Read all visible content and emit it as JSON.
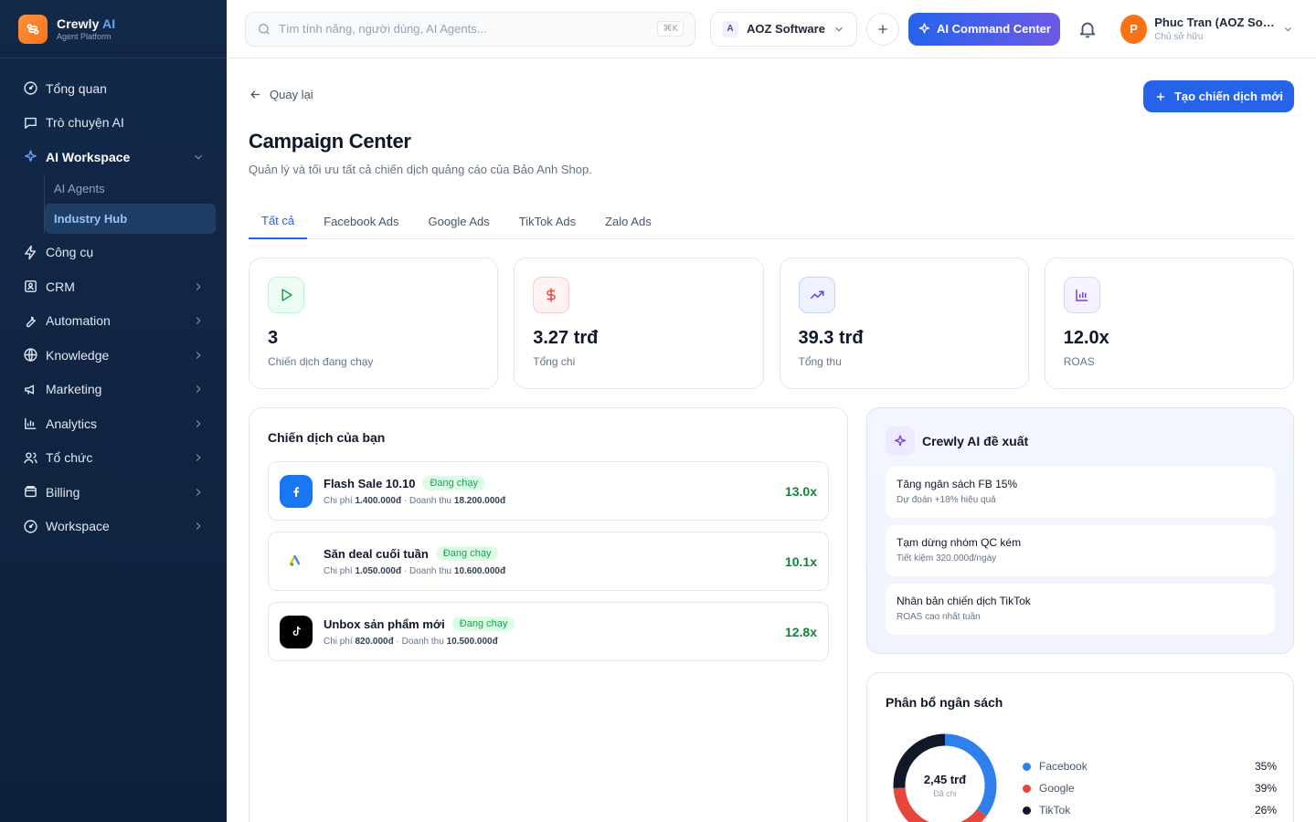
{
  "brand": {
    "name": "Crewly",
    "name_accent": "AI",
    "subtitle": "Agent Platform"
  },
  "sidebar": {
    "items": [
      {
        "label": "Tổng quan",
        "icon": "dashboard-icon"
      },
      {
        "label": "Trò chuyện AI",
        "icon": "chat-icon"
      },
      {
        "label": "AI Workspace",
        "icon": "sparkle-icon",
        "expanded": true
      },
      {
        "label": "Công cụ",
        "icon": "bolt-icon"
      },
      {
        "label": "CRM",
        "icon": "contact-icon"
      },
      {
        "label": "Automation",
        "icon": "wrench-icon"
      },
      {
        "label": "Knowledge",
        "icon": "globe-icon"
      },
      {
        "label": "Marketing",
        "icon": "megaphone-icon"
      },
      {
        "label": "Analytics",
        "icon": "bar-chart-icon"
      },
      {
        "label": "Tổ chức",
        "icon": "users-icon"
      },
      {
        "label": "Billing",
        "icon": "wallet-icon"
      },
      {
        "label": "Workspace",
        "icon": "dashboard-icon"
      }
    ],
    "sub_items": [
      {
        "label": "AI Agents"
      },
      {
        "label": "Industry Hub",
        "active": true
      }
    ]
  },
  "header": {
    "search_placeholder": "Tìm tính năng, người dùng, AI Agents...",
    "search_shortcut": "⌘K",
    "org_badge": "A",
    "org_name": "AOZ Software",
    "ai_button": "AI Command Center",
    "user_initial": "P",
    "user_name": "Phuc Tran (AOZ Software)",
    "user_role": "Chủ sở hữu"
  },
  "main": {
    "back_label": "Quay lại",
    "create_button": "Tạo chiến dịch mới",
    "title": "Campaign Center",
    "subtitle": "Quản lý và tối ưu tất cả chiến dịch quảng cáo của Bảo Anh Shop.",
    "tabs": [
      "Tất cả",
      "Facebook Ads",
      "Google Ads",
      "TikTok Ads",
      "Zalo Ads"
    ],
    "active_tab": 0
  },
  "stats": [
    {
      "value": "3",
      "label": "Chiến dịch đang chạy",
      "icon": "play-icon",
      "color": "#16a34a"
    },
    {
      "value": "3.27 trđ",
      "label": "Tổng chi",
      "icon": "dollar-icon",
      "color": "#ef4444"
    },
    {
      "value": "39.3 trđ",
      "label": "Tổng thu",
      "icon": "trending-up-icon",
      "color": "#4f46e5"
    },
    {
      "value": "12.0x",
      "label": "ROAS",
      "icon": "bar-chart-icon",
      "color": "#7c3aed"
    }
  ],
  "campaigns": {
    "title": "Chiến dịch của bạn",
    "items": [
      {
        "name": "Flash Sale 10.10",
        "status": "Đang chạy",
        "cost_label": "Chi phí",
        "cost": "1.400.000đ",
        "revenue_label": "Doanh thu",
        "revenue": "18.200.000đ",
        "roas": "13.0x",
        "platform_icon": "facebook-icon"
      },
      {
        "name": "Săn deal cuối tuần",
        "status": "Đang chạy",
        "cost_label": "Chi phí",
        "cost": "1.050.000đ",
        "revenue_label": "Doanh thu",
        "revenue": "10.600.000đ",
        "roas": "10.1x",
        "platform_icon": "google-ads-icon"
      },
      {
        "name": "Unbox sản phẩm mới",
        "status": "Đang chạy",
        "cost_label": "Chi phí",
        "cost": "820.000đ",
        "revenue_label": "Doanh thu",
        "revenue": "10.500.000đ",
        "roas": "12.8x",
        "platform_icon": "tiktok-icon"
      }
    ]
  },
  "ai_suggestions": {
    "title": "Crewly AI đề xuất",
    "items": [
      {
        "title": "Tăng ngân sách FB 15%",
        "sub": "Dự đoán +18% hiệu quả"
      },
      {
        "title": "Tạm dừng nhóm QC kém",
        "sub": "Tiết kiệm 320.000đ/ngày"
      },
      {
        "title": "Nhân bản chiến dịch TikTok",
        "sub": "ROAS cao nhất tuần"
      }
    ]
  },
  "budget": {
    "title": "Phân bổ ngân sách",
    "center_value": "2,45 trđ",
    "center_label": "Đã chi",
    "segments": [
      {
        "name": "Facebook",
        "pct_label": "35%",
        "pct": 35,
        "color": "#2f80ed"
      },
      {
        "name": "Google",
        "pct_label": "39%",
        "pct": 39,
        "color": "#e8453c"
      },
      {
        "name": "TikTok",
        "pct_label": "26%",
        "pct": 26,
        "color": "#111827"
      }
    ]
  }
}
